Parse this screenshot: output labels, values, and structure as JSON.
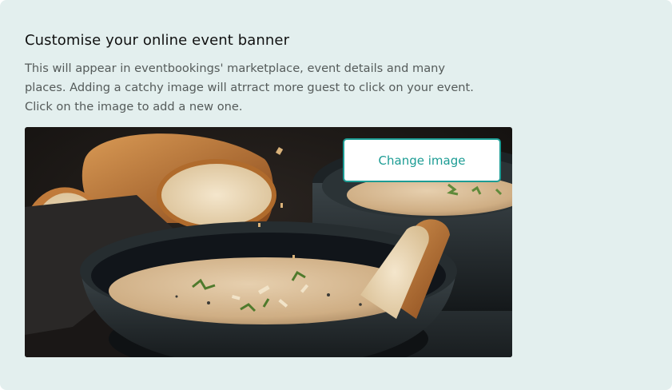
{
  "banner_section": {
    "title": "Customise your online event banner",
    "description_lines": [
      "This will appear in eventbookings' marketplace, event details and many",
      "places. Adding a catchy image will atrract more guest to click on your event.",
      "Click on the image to add a new one."
    ],
    "image_alt": "Bowl of creamy soup with bread slices",
    "change_button_label": "Change image"
  },
  "colors": {
    "card_background": "#e3efee",
    "accent": "#1c9c94",
    "title_text": "#111111",
    "body_text": "#555b5a"
  }
}
